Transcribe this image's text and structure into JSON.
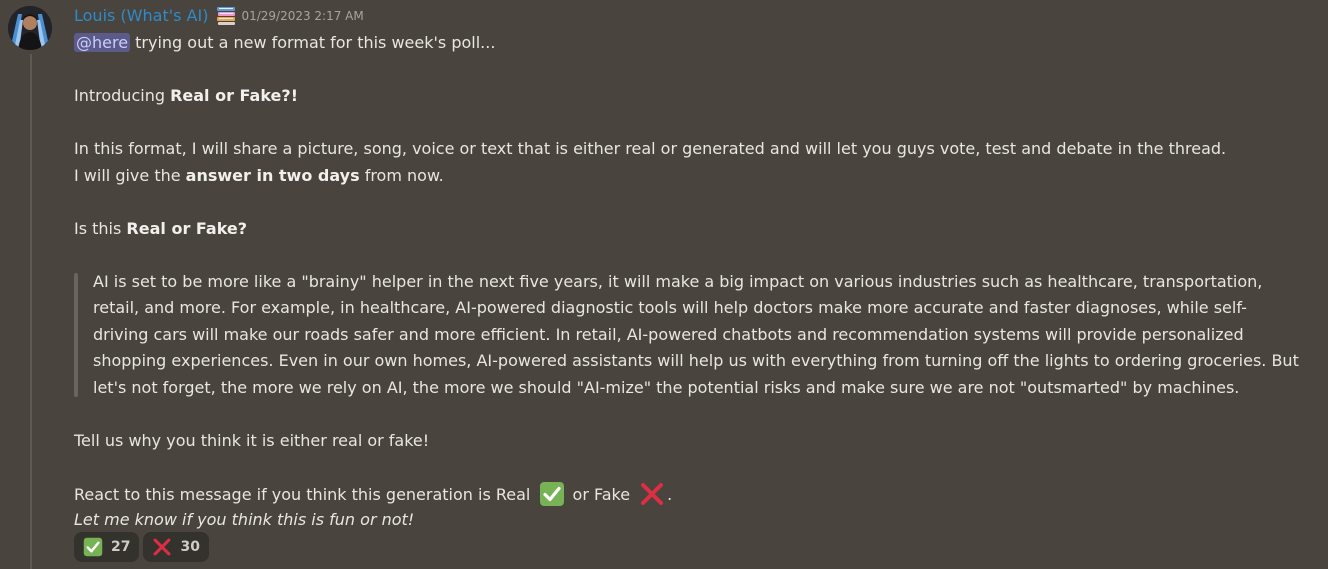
{
  "author": {
    "name": "Louis (What's AI)",
    "timestamp": "01/29/2023 2:17 AM",
    "role_icon": "books-icon"
  },
  "message": {
    "mention": "@here",
    "line1_rest": " trying out a new format for this week's poll...",
    "line2_pre": "Introducing ",
    "line2_bold": "Real or Fake?!",
    "line3": "In this format, I will share a picture, song, voice or text that is either real or generated and will let you guys vote, test and debate in the thread.",
    "line4_pre": "I will give the ",
    "line4_bold": "answer in two days",
    "line4_post": " from now.",
    "line5_pre": "Is this ",
    "line5_bold": "Real or Fake?",
    "quote": [
      "AI is set to be more like a \"brainy\" helper in the next five years, it will make a big impact on various industries such as healthcare, transportation,",
      "retail, and more. For example, in healthcare, AI-powered diagnostic tools will help doctors make more accurate and faster diagnoses, while self-",
      "driving cars will make our roads safer and more efficient. In retail, AI-powered chatbots and recommendation systems will provide personalized",
      "shopping experiences. Even in our own homes, AI-powered assistants will help us with everything from turning off the lights to ordering groceries. But",
      "let's not forget, the more we rely on AI, the more we should \"AI-mize\" the potential risks and make sure we are not \"outsmarted\" by machines."
    ],
    "line6": "Tell us why you think it is either real or fake!",
    "line7_pre": "React to this message if you think this generation is Real ",
    "line7_mid": " or Fake ",
    "line7_post": ".",
    "line8_italic": "Let me know if you think this is fun or not!"
  },
  "reactions": [
    {
      "emoji": "check-mark-icon",
      "count": "27"
    },
    {
      "emoji": "cross-mark-icon",
      "count": "30"
    }
  ],
  "colors": {
    "background": "#49443d",
    "username": "#2f8ac9",
    "mention_bg": "#5b5a88",
    "check_green": "#77b255",
    "cross_red": "#dd2e44"
  }
}
